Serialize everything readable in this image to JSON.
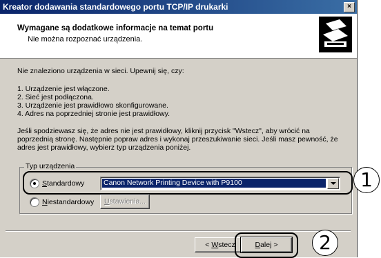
{
  "window": {
    "title": "Kreator dodawania standardowego portu TCP/IP drukarki",
    "close_glyph": "×"
  },
  "header": {
    "title": "Wymagane są dodatkowe informacje na temat portu",
    "subtitle": "Nie można rozpoznać urządzenia."
  },
  "body": {
    "intro": "Nie znaleziono urządzenia w sieci. Upewnij się, czy:",
    "checklist": [
      "1. Urządzenie jest włączone.",
      "2. Sieć jest podłączona.",
      "3. Urządzenie jest prawidłowo skonfigurowane.",
      "4. Adres na poprzedniej stronie jest prawidłowy."
    ],
    "advice": [
      "Jeśli spodziewasz się, że adres nie jest prawidłowy, kliknij przycisk \"Wstecz\", aby wrócić na",
      "poprzednią stronę. Następnie popraw adres i wykonaj przeszukiwanie sieci. Jeśli masz pewność, że",
      "adres jest prawidłowy, wybierz typ urządzenia poniżej."
    ]
  },
  "device_type": {
    "legend": "Typ urządzenia",
    "standard": {
      "label_prefix": "S",
      "label_rest": "tandardowy",
      "selected": true
    },
    "custom": {
      "label_prefix": "N",
      "label_rest": "iestandardowy",
      "selected": false
    },
    "select_value": "Canon Network Printing Device with P9100",
    "settings_prefix": "U",
    "settings_rest": "stawienia..."
  },
  "nav": {
    "back_prefix": "< ",
    "back_u": "W",
    "back_rest": "stecz",
    "next_u": "D",
    "next_rest": "alej >"
  },
  "callouts": {
    "one": "1",
    "two": "2"
  }
}
